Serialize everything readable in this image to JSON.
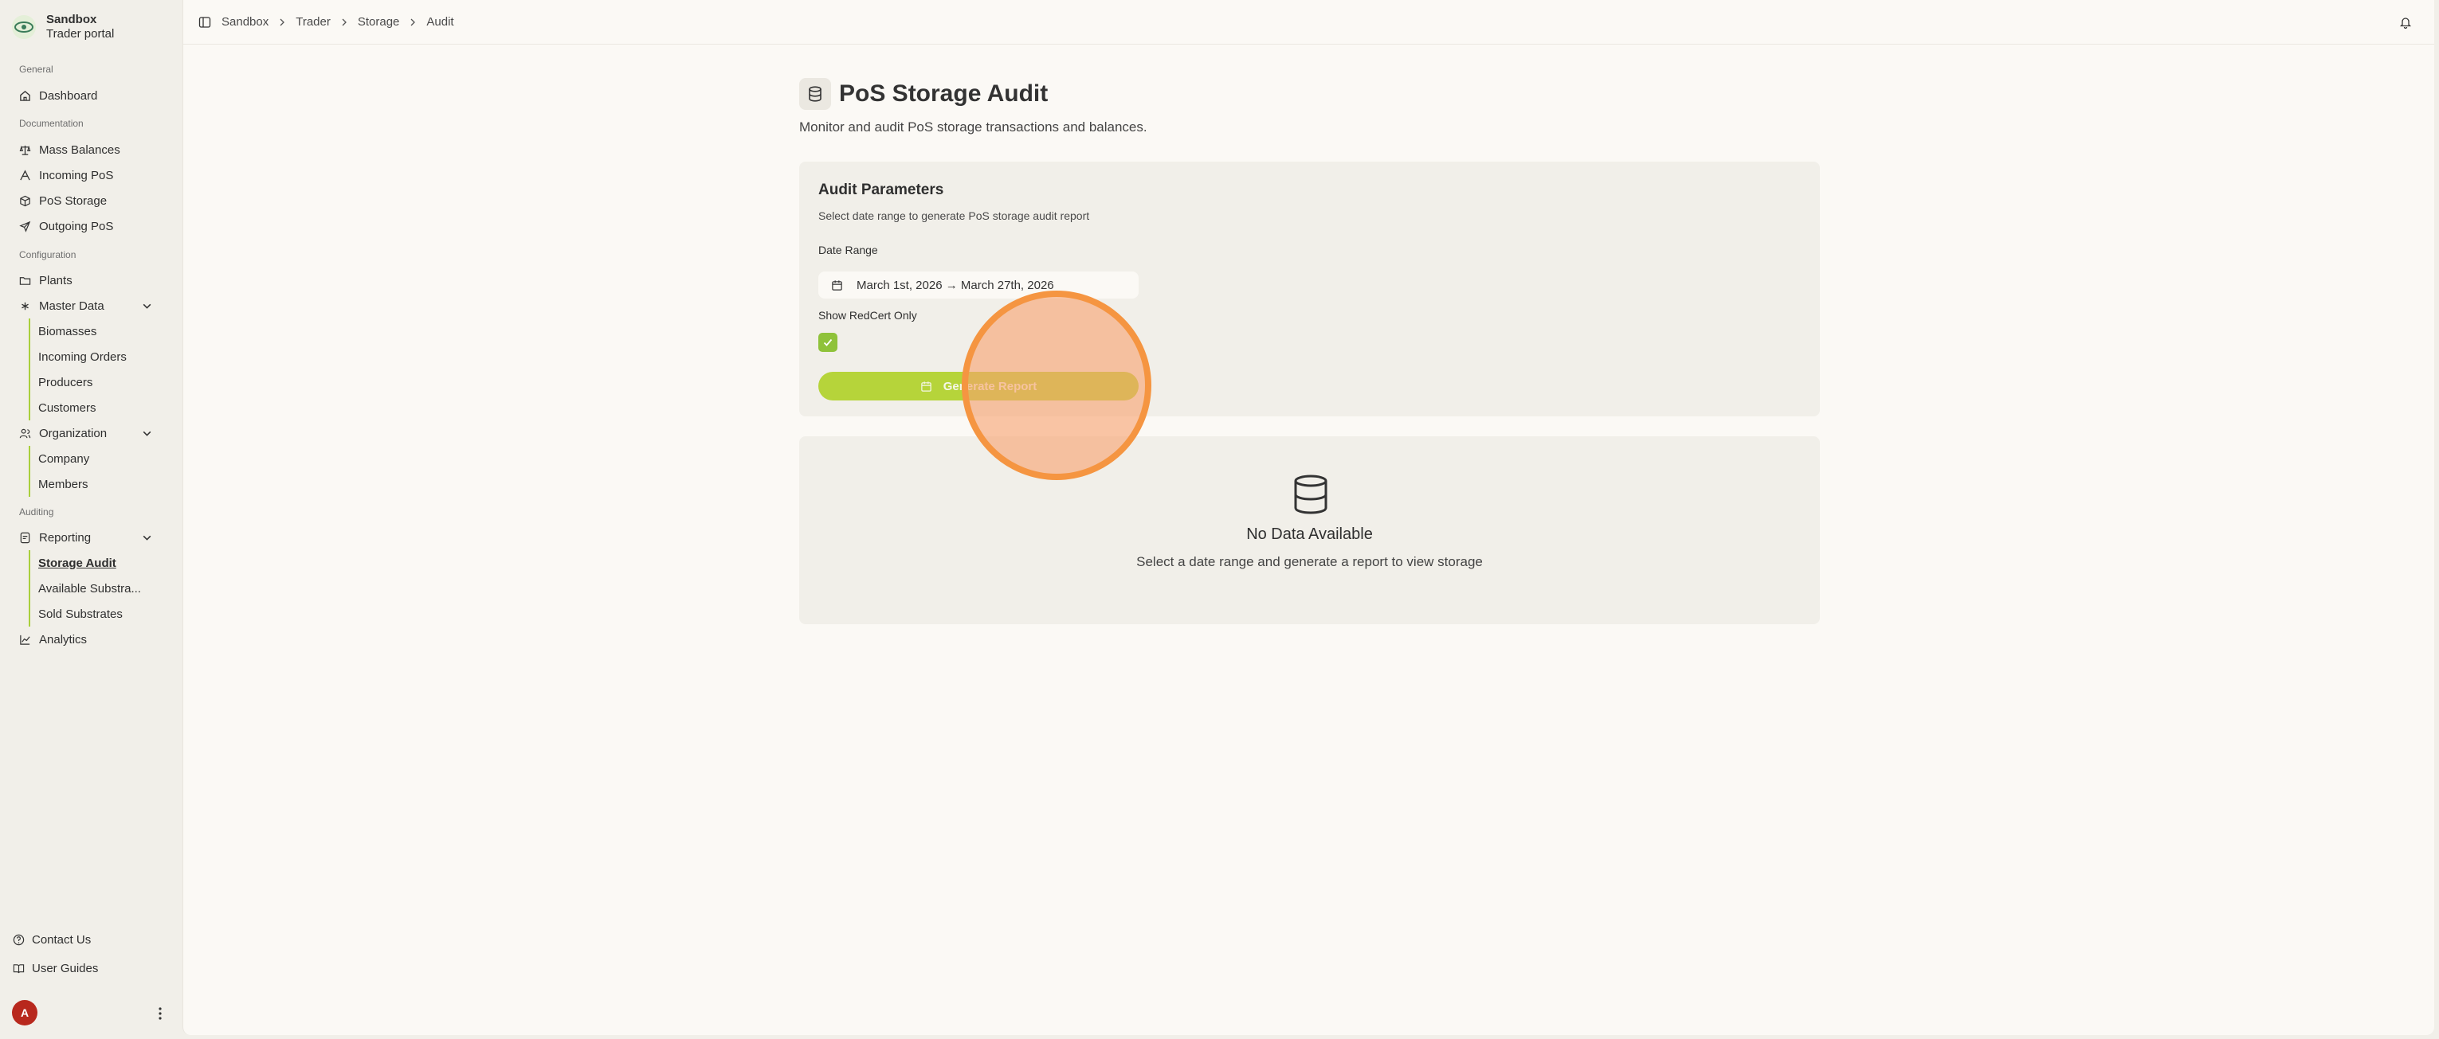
{
  "brand": {
    "name": "Sandbox",
    "subtitle": "Trader portal"
  },
  "sidebar": {
    "general_label": "General",
    "dashboard": "Dashboard",
    "documentation_label": "Documentation",
    "mass_balances": "Mass Balances",
    "incoming_pos": "Incoming PoS",
    "pos_storage": "PoS Storage",
    "outgoing_pos": "Outgoing PoS",
    "configuration_label": "Configuration",
    "plants": "Plants",
    "master_data": "Master Data",
    "master_data_items": [
      "Biomasses",
      "Incoming Orders",
      "Producers",
      "Customers"
    ],
    "organization": "Organization",
    "organization_items": [
      "Company",
      "Members"
    ],
    "auditing_label": "Auditing",
    "reporting": "Reporting",
    "reporting_items": [
      "Storage Audit",
      "Available Substra...",
      "Sold Substrates"
    ],
    "analytics": "Analytics",
    "contact_us": "Contact Us",
    "user_guides": "User Guides",
    "avatar_initial": "A"
  },
  "breadcrumb": [
    "Sandbox",
    "Trader",
    "Storage",
    "Audit"
  ],
  "page": {
    "title": "PoS Storage Audit",
    "description": "Monitor and audit PoS storage transactions and balances."
  },
  "params": {
    "title": "Audit Parameters",
    "description": "Select date range to generate PoS storage audit report",
    "date_range_label": "Date Range",
    "date_range_value": "March 1st, 2026 → March 27th, 2026",
    "redcert_label": "Show RedCert Only",
    "redcert_checked": true,
    "generate_label": "Generate Report"
  },
  "empty": {
    "title": "No Data Available",
    "description": "Select a date range and generate a report to view storage"
  },
  "colors": {
    "accent": "#b6d43a",
    "checkbox": "#8fc23a",
    "avatar": "#b8281d",
    "cursor": "#f59541"
  }
}
